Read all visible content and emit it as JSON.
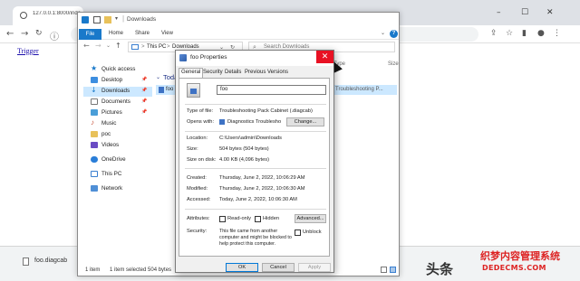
{
  "browser": {
    "tab_title": "127.0.0.1:8000/inde",
    "link_text": "Trigger",
    "download_filename": "foo.diagcab"
  },
  "explorer": {
    "title": "Downloads",
    "ribbon": {
      "file": "File",
      "tabs": [
        "Home",
        "Share",
        "View"
      ],
      "help": "?"
    },
    "address": {
      "parts": [
        "This PC",
        "Downloads"
      ],
      "separator": ">"
    },
    "search_placeholder": "Search Downloads",
    "nav": [
      {
        "label": "Quick access",
        "icon": "star-icon",
        "pinned": false
      },
      {
        "label": "Desktop",
        "icon": "desktop-folder-icon",
        "pinned": true
      },
      {
        "label": "Downloads",
        "icon": "downloads-folder-icon",
        "pinned": true,
        "selected": true
      },
      {
        "label": "Documents",
        "icon": "documents-folder-icon",
        "pinned": true
      },
      {
        "label": "Pictures",
        "icon": "pictures-folder-icon",
        "pinned": true
      },
      {
        "label": "Music",
        "icon": "music-icon",
        "pinned": false
      },
      {
        "label": "poc",
        "icon": "folder-icon",
        "pinned": false
      },
      {
        "label": "Videos",
        "icon": "videos-folder-icon",
        "pinned": false
      },
      {
        "label": "OneDrive",
        "icon": "onedrive-icon",
        "pinned": false
      },
      {
        "label": "This PC",
        "icon": "this-pc-icon",
        "pinned": false
      },
      {
        "label": "Network",
        "icon": "network-icon",
        "pinned": false
      }
    ],
    "columns": {
      "type": "Type",
      "size": "Size"
    },
    "group_label": "Today",
    "file": {
      "name": "foo",
      "type": "Troubleshooting P..."
    },
    "status": {
      "items": "1 item",
      "selected": "1 item selected  504 bytes"
    }
  },
  "dialog": {
    "title": "foo Properties",
    "tabs": [
      "General",
      "Security",
      "Details",
      "Previous Versions"
    ],
    "active_tab": "General",
    "name_value": "foo",
    "fields": {
      "type_label": "Type of file:",
      "type_value": "Troubleshooting Pack Cabinet (.diagcab)",
      "opens_label": "Opens with:",
      "opens_value": "Diagnostics Troublesho",
      "change_button": "Change...",
      "location_label": "Location:",
      "location_value": "C:\\Users\\admin\\Downloads",
      "size_label": "Size:",
      "size_value": "504 bytes (504 bytes)",
      "disk_label": "Size on disk:",
      "disk_value": "4.00 KB (4,096 bytes)",
      "created_label": "Created:",
      "created_value": "Thursday, June 2, 2022, 10:06:29 AM",
      "modified_label": "Modified:",
      "modified_value": "Thursday, June 2, 2022, 10:06:30 AM",
      "accessed_label": "Accessed:",
      "accessed_value": "Today, June 2, 2022, 10:06:30 AM",
      "attributes_label": "Attributes:",
      "readonly_label": "Read-only",
      "hidden_label": "Hidden",
      "advanced_button": "Advanced...",
      "security_label": "Security:",
      "security_text_1": "This file came from another",
      "security_text_2": "computer and might be blocked to",
      "security_text_3": "help protect this computer.",
      "unblock_label": "Unblock"
    },
    "buttons": {
      "ok": "OK",
      "cancel": "Cancel",
      "apply": "Apply"
    }
  },
  "watermark": {
    "logo_text": "头条",
    "cn_text": "织梦内容管理系统",
    "url": "DEDECMS.COM"
  },
  "colors": {
    "accent": "#1979ca",
    "close_red": "#e81123",
    "selection": "#cce8ff"
  }
}
